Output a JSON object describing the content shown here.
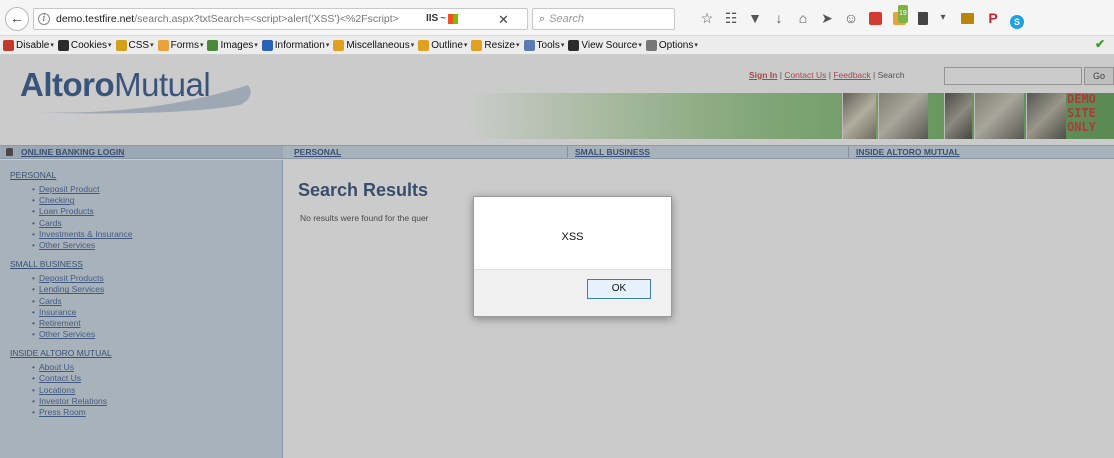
{
  "browser": {
    "url_host": "demo.testfire.net",
    "url_path": "/search.aspx?txtSearch=<script>alert('XSS')<%2Fscript>",
    "extension_label": "IIS",
    "search_placeholder": "Search",
    "toolbar_icons": [
      "star-icon",
      "reading-list-icon",
      "pocket-icon",
      "download-icon",
      "home-icon",
      "send-icon",
      "chat-icon",
      "red-extension-icon",
      "badge-extension-icon",
      "bookmark-extension-icon",
      "dropdown-icon",
      "folder-extension-icon",
      "pinterest-icon",
      "skype-icon"
    ],
    "extension_badge_count": "19"
  },
  "dev_toolbar": {
    "items": [
      {
        "label": "Disable",
        "color": "#c0392b"
      },
      {
        "label": "Cookies",
        "color": "#2b2b2b"
      },
      {
        "label": "CSS",
        "color": "#d4a017"
      },
      {
        "label": "Forms",
        "color": "#e8a33c"
      },
      {
        "label": "Images",
        "color": "#4a8a3a"
      },
      {
        "label": "Information",
        "color": "#2a62b8"
      },
      {
        "label": "Miscellaneous",
        "color": "#e0a020"
      },
      {
        "label": "Outline",
        "color": "#e0a020"
      },
      {
        "label": "Resize",
        "color": "#e0a020"
      },
      {
        "label": "Tools",
        "color": "#5a7ab0"
      },
      {
        "label": "View Source",
        "color": "#2b2b2b"
      },
      {
        "label": "Options",
        "color": "#777777"
      }
    ]
  },
  "site": {
    "logo_bold": "Altoro",
    "logo_regular": "Mutual",
    "header_links": {
      "sign_in": "Sign In",
      "sep1": "|",
      "contact": "Contact Us",
      "sep2": "|",
      "feedback": "Feedback",
      "sep3": "|",
      "search_label": "Search"
    },
    "go_button": "Go",
    "demo_lines": [
      "DEMO",
      "SITE",
      "ONLY"
    ],
    "nav": {
      "login": "ONLINE BANKING LOGIN",
      "personal": "PERSONAL",
      "small_business": "SMALL BUSINESS",
      "inside": "INSIDE ALTORO MUTUAL"
    },
    "sidebar": [
      {
        "category": "PERSONAL",
        "items": [
          "Deposit Product",
          "Checking",
          "Loan Products",
          "Cards",
          "Investments & Insurance",
          "Other Services"
        ]
      },
      {
        "category": "SMALL BUSINESS",
        "items": [
          "Deposit Products",
          "Lending Services",
          "Cards",
          "Insurance",
          "Retirement",
          "Other Services"
        ]
      },
      {
        "category": "INSIDE ALTORO MUTUAL",
        "items": [
          "About Us",
          "Contact Us",
          "Locations",
          "Investor Relations",
          "Press Room"
        ]
      }
    ],
    "results_title": "Search Results",
    "results_text": "No results were found for the quer"
  },
  "alert": {
    "message": "XSS",
    "ok_label": "OK"
  },
  "colors": {
    "brand_blue": "#1b4583",
    "link_red": "#c13232",
    "nav_bg": "#c9d8e6",
    "demo_red": "#cc1f1f"
  }
}
